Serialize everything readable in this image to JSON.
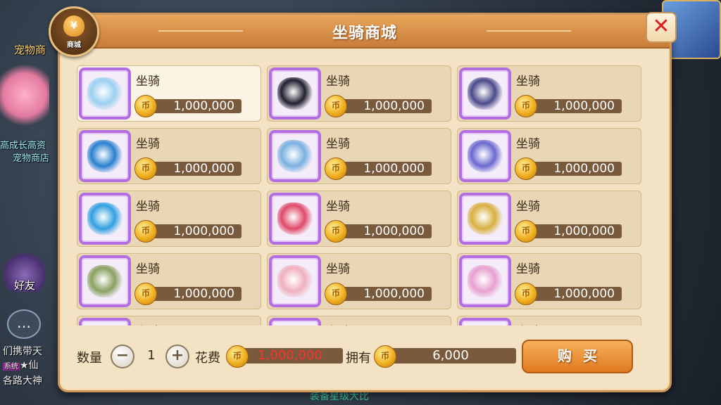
{
  "background": {
    "pet_shop_label": "宠物商",
    "promo_line1": "高成长高资",
    "promo_line2": "宠物商店",
    "friends_label": "好友",
    "chat_lines": [
      "们携带天",
      "★仙",
      "各路大神"
    ],
    "chat_badge": "系统",
    "bottom_text": "装备星级大比"
  },
  "dialog": {
    "title": "坐骑商城",
    "shop_badge_label": "商城",
    "close_icon": "close-x-icon"
  },
  "items": [
    {
      "name": "坐骑",
      "price": "1,000,000",
      "color": "#9ad0f0",
      "selected": true
    },
    {
      "name": "坐骑",
      "price": "1,000,000",
      "color": "#202030"
    },
    {
      "name": "坐骑",
      "price": "1,000,000",
      "color": "#4a4a8a"
    },
    {
      "name": "坐骑",
      "price": "1,000,000",
      "color": "#2a80d0"
    },
    {
      "name": "坐骑",
      "price": "1,000,000",
      "color": "#7ab0e0"
    },
    {
      "name": "坐骑",
      "price": "1,000,000",
      "color": "#6a6ad0"
    },
    {
      "name": "坐骑",
      "price": "1,000,000",
      "color": "#30a0e0"
    },
    {
      "name": "坐骑",
      "price": "1,000,000",
      "color": "#e04a6a"
    },
    {
      "name": "坐骑",
      "price": "1,000,000",
      "color": "#d8b040"
    },
    {
      "name": "坐骑",
      "price": "1,000,000",
      "color": "#8aa060"
    },
    {
      "name": "坐骑",
      "price": "1,000,000",
      "color": "#f0b0c0"
    },
    {
      "name": "坐骑",
      "price": "1,000,000",
      "color": "#e8a0d0"
    },
    {
      "name": "坐骑",
      "price": "",
      "color": "#d0c0e0"
    },
    {
      "name": "坐骑",
      "price": "",
      "color": "#d0c0e0"
    },
    {
      "name": "坐骑",
      "price": "",
      "color": "#d0c0e0"
    }
  ],
  "footer": {
    "quantity_label": "数量",
    "minus": "−",
    "quantity_value": "1",
    "plus": "+",
    "cost_label": "花费",
    "cost_value": "1,000,000",
    "owned_label": "拥有",
    "owned_value": "6,000",
    "buy_label": "购买"
  },
  "coin_glyph": "币"
}
